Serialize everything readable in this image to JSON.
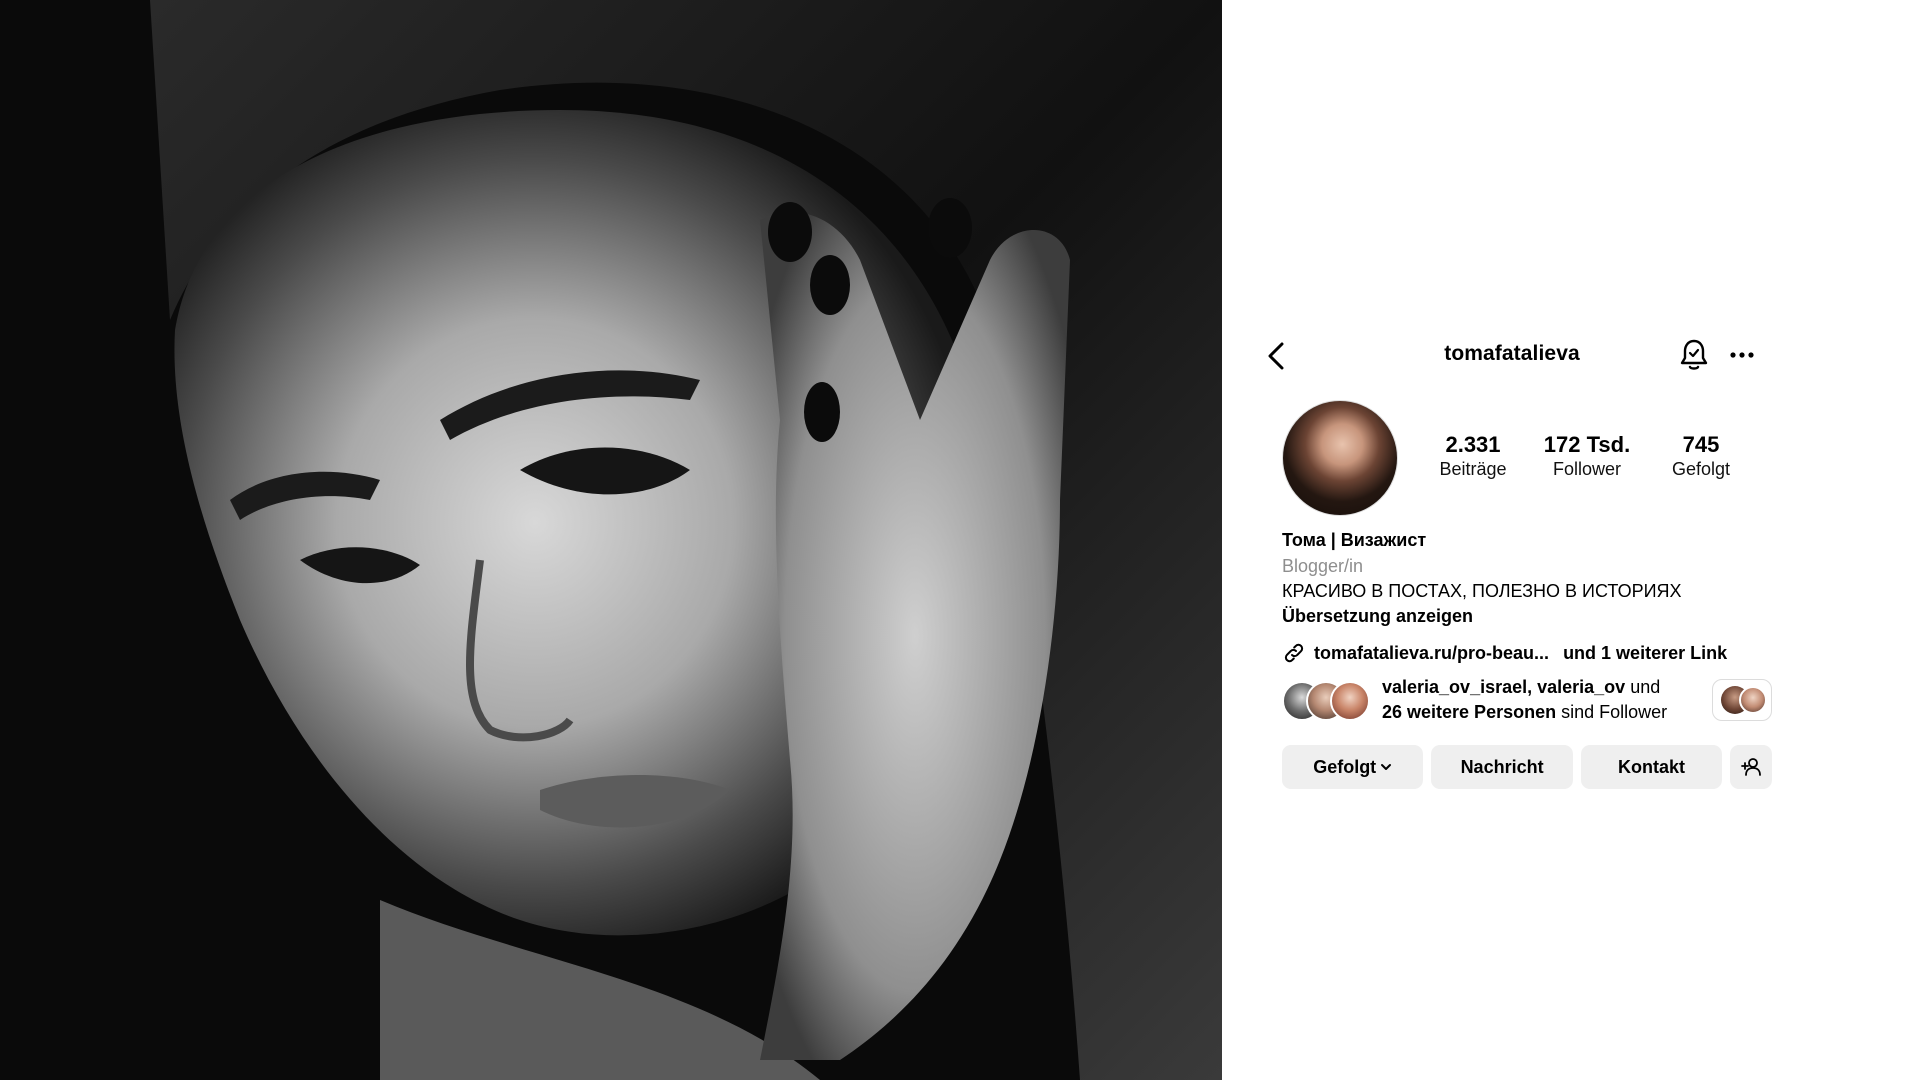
{
  "header": {
    "username": "tomafatalieva"
  },
  "stats": [
    {
      "value": "2.331",
      "label": "Beiträge"
    },
    {
      "value": "172 Tsd.",
      "label": "Follower"
    },
    {
      "value": "745",
      "label": "Gefolgt"
    }
  ],
  "bio": {
    "name": "Тома | Визажист",
    "category": "Blogger/in",
    "text": "КРАСИВО В ПОСТАХ, ПОЛЕЗНО В ИСТОРИЯХ",
    "translate": "Übersetzung anzeigen"
  },
  "link": {
    "url": "tomafatalieva.ru/pro-beau...",
    "more": "und 1 weiterer Link"
  },
  "followed_by": {
    "names": "valeria_ov_israel, valeria_ov",
    "and": "und",
    "count": "26 weitere Personen",
    "suffix": "sind Follower"
  },
  "actions": {
    "follow": "Gefolgt",
    "message": "Nachricht",
    "contact": "Kontakt"
  },
  "icons": {
    "back": "chevron-left-icon",
    "notifications": "bell-icon",
    "more": "ellipsis-icon",
    "link": "link-icon",
    "add_person": "add-person-icon",
    "dropdown": "chevron-down-icon"
  }
}
